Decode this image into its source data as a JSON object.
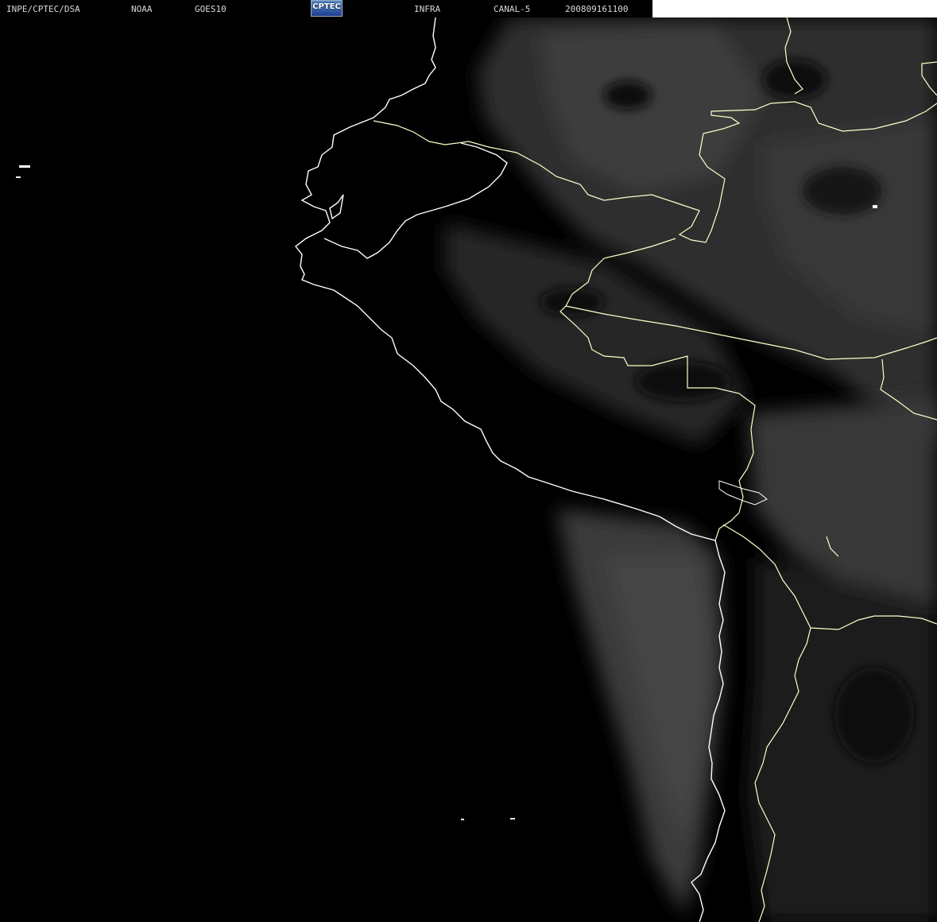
{
  "header": {
    "source": "INPE/CPTEC/DSA",
    "agency": "NOAA",
    "satellite": "GOES10",
    "logo_text": "CPTEC",
    "product": "INFRA",
    "channel": "CANAL-5",
    "datetime": "200809161100"
  },
  "colors": {
    "background": "#000000",
    "coastline": "#ffffff",
    "border": "#ffffcc",
    "cloud_gray": "#3a3a3a",
    "stratus_gray": "#363636"
  },
  "icons": {
    "logo": "cptec-logo"
  }
}
